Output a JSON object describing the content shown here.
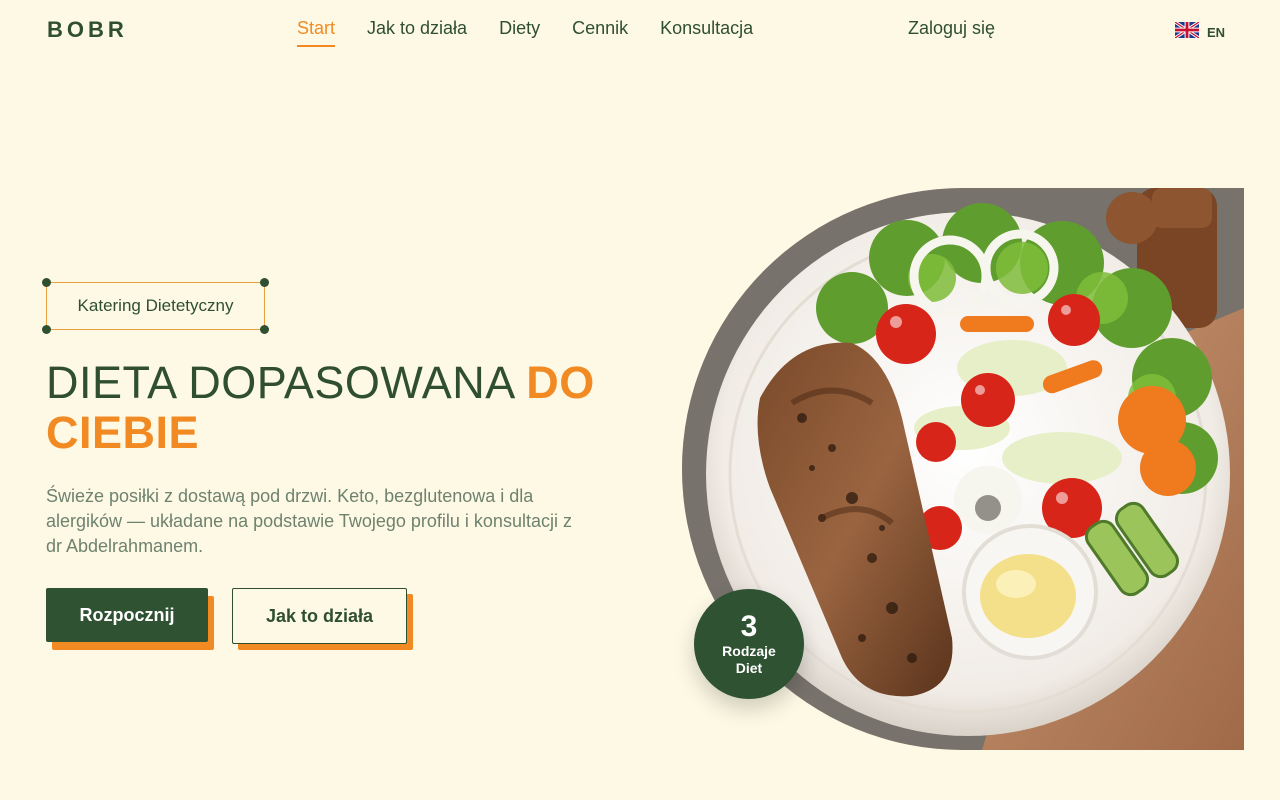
{
  "brand": {
    "name": "BOBR"
  },
  "nav": {
    "items": [
      {
        "label": "Start",
        "active": true
      },
      {
        "label": "Jak to działa",
        "active": false
      },
      {
        "label": "Diety",
        "active": false
      },
      {
        "label": "Cennik",
        "active": false
      },
      {
        "label": "Konsultacja",
        "active": false
      }
    ],
    "login": "Zaloguj się",
    "language": {
      "code": "EN",
      "icon": "uk-flag-icon"
    }
  },
  "hero": {
    "badge": "Katering Dietetyczny",
    "title_main": "DIETA DOPASOWANA ",
    "title_accent": "DO CIEBIE",
    "description": "Świeże posiłki z dostawą pod drzwi. Keto, bezglutenowa i dla alergików — układane na podstawie Twojego profilu i konsultacji z dr Abdelrahmanem.",
    "cta_primary": "Rozpocznij",
    "cta_secondary": "Jak to działa",
    "stat": {
      "value": "3",
      "label": "Rodzaje Diet"
    }
  },
  "colors": {
    "background": "#fdf9e4",
    "primary_green": "#2f5233",
    "accent_orange": "#f28a24",
    "muted_text": "#6f8270"
  }
}
